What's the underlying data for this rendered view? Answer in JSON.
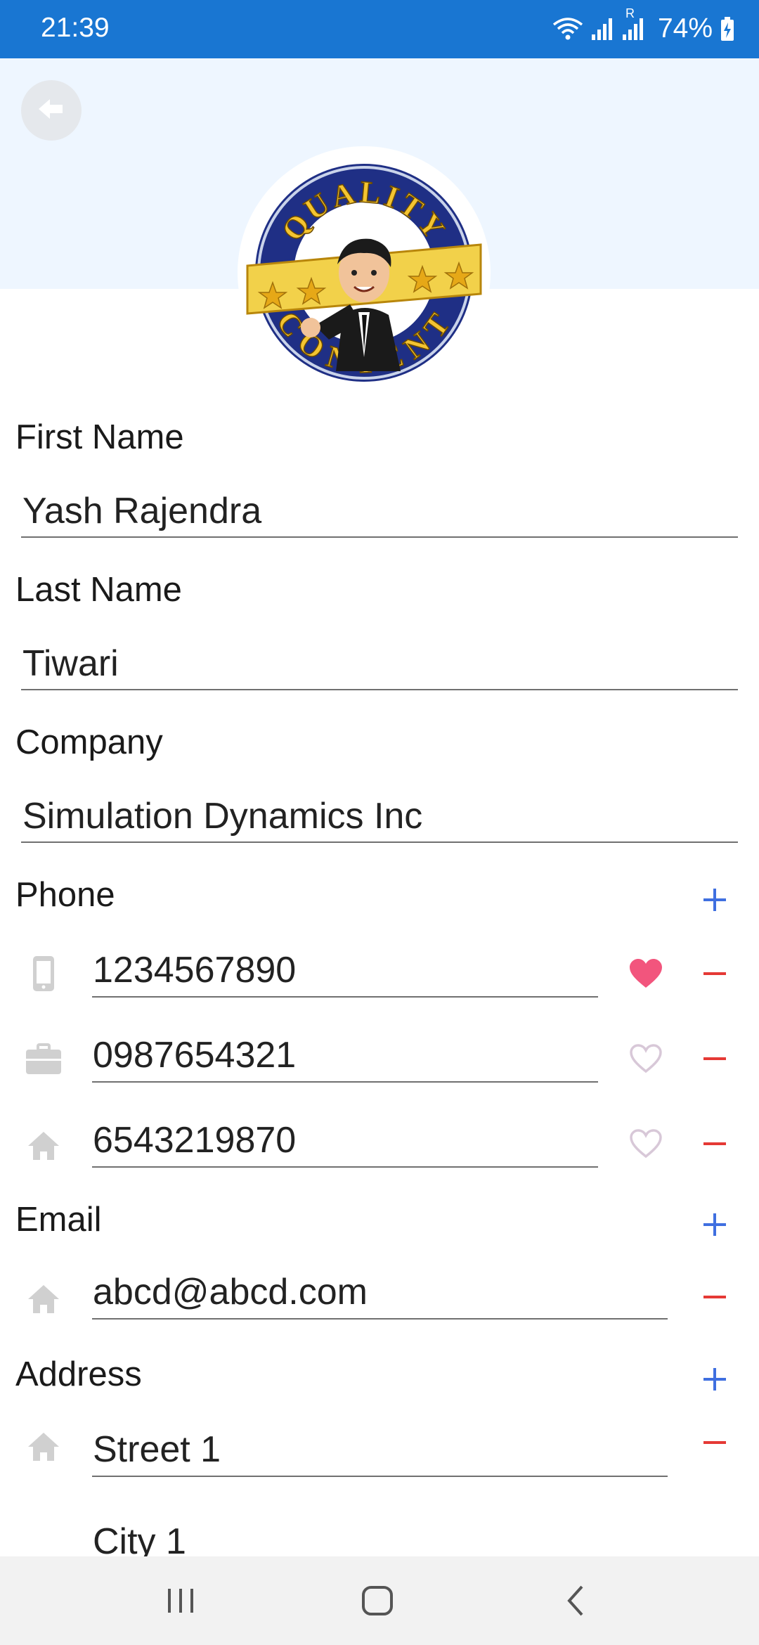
{
  "status": {
    "time": "21:39",
    "battery": "74%",
    "network_indicator": "R"
  },
  "avatar": {
    "logo_text_top": "QUALITY",
    "logo_text_bottom": "CONTENT"
  },
  "form": {
    "first_name": {
      "label": "First Name",
      "value": "Yash Rajendra"
    },
    "last_name": {
      "label": "Last Name",
      "value": "Tiwari"
    },
    "company": {
      "label": "Company",
      "value": "Simulation Dynamics Inc"
    },
    "phone": {
      "label": "Phone",
      "entries": [
        {
          "type_icon": "mobile-icon",
          "value": "1234567890",
          "favorite": true
        },
        {
          "type_icon": "briefcase-icon",
          "value": "0987654321",
          "favorite": false
        },
        {
          "type_icon": "home-icon",
          "value": "6543219870",
          "favorite": false
        }
      ]
    },
    "email": {
      "label": "Email",
      "entries": [
        {
          "type_icon": "home-icon",
          "value": "abcd@abcd.com"
        }
      ]
    },
    "address": {
      "label": "Address",
      "entries": [
        {
          "type_icon": "home-icon",
          "street": "Street 1",
          "city": "City 1"
        }
      ]
    }
  },
  "colors": {
    "status_bar": "#1976d2",
    "header_band": "#eef6ff",
    "add_blue": "#3f6fe0",
    "remove_red": "#e53935",
    "favorite_pink": "#f2557d",
    "favorite_outline": "#d8c8d8",
    "icon_grey": "#d0d0d0"
  }
}
